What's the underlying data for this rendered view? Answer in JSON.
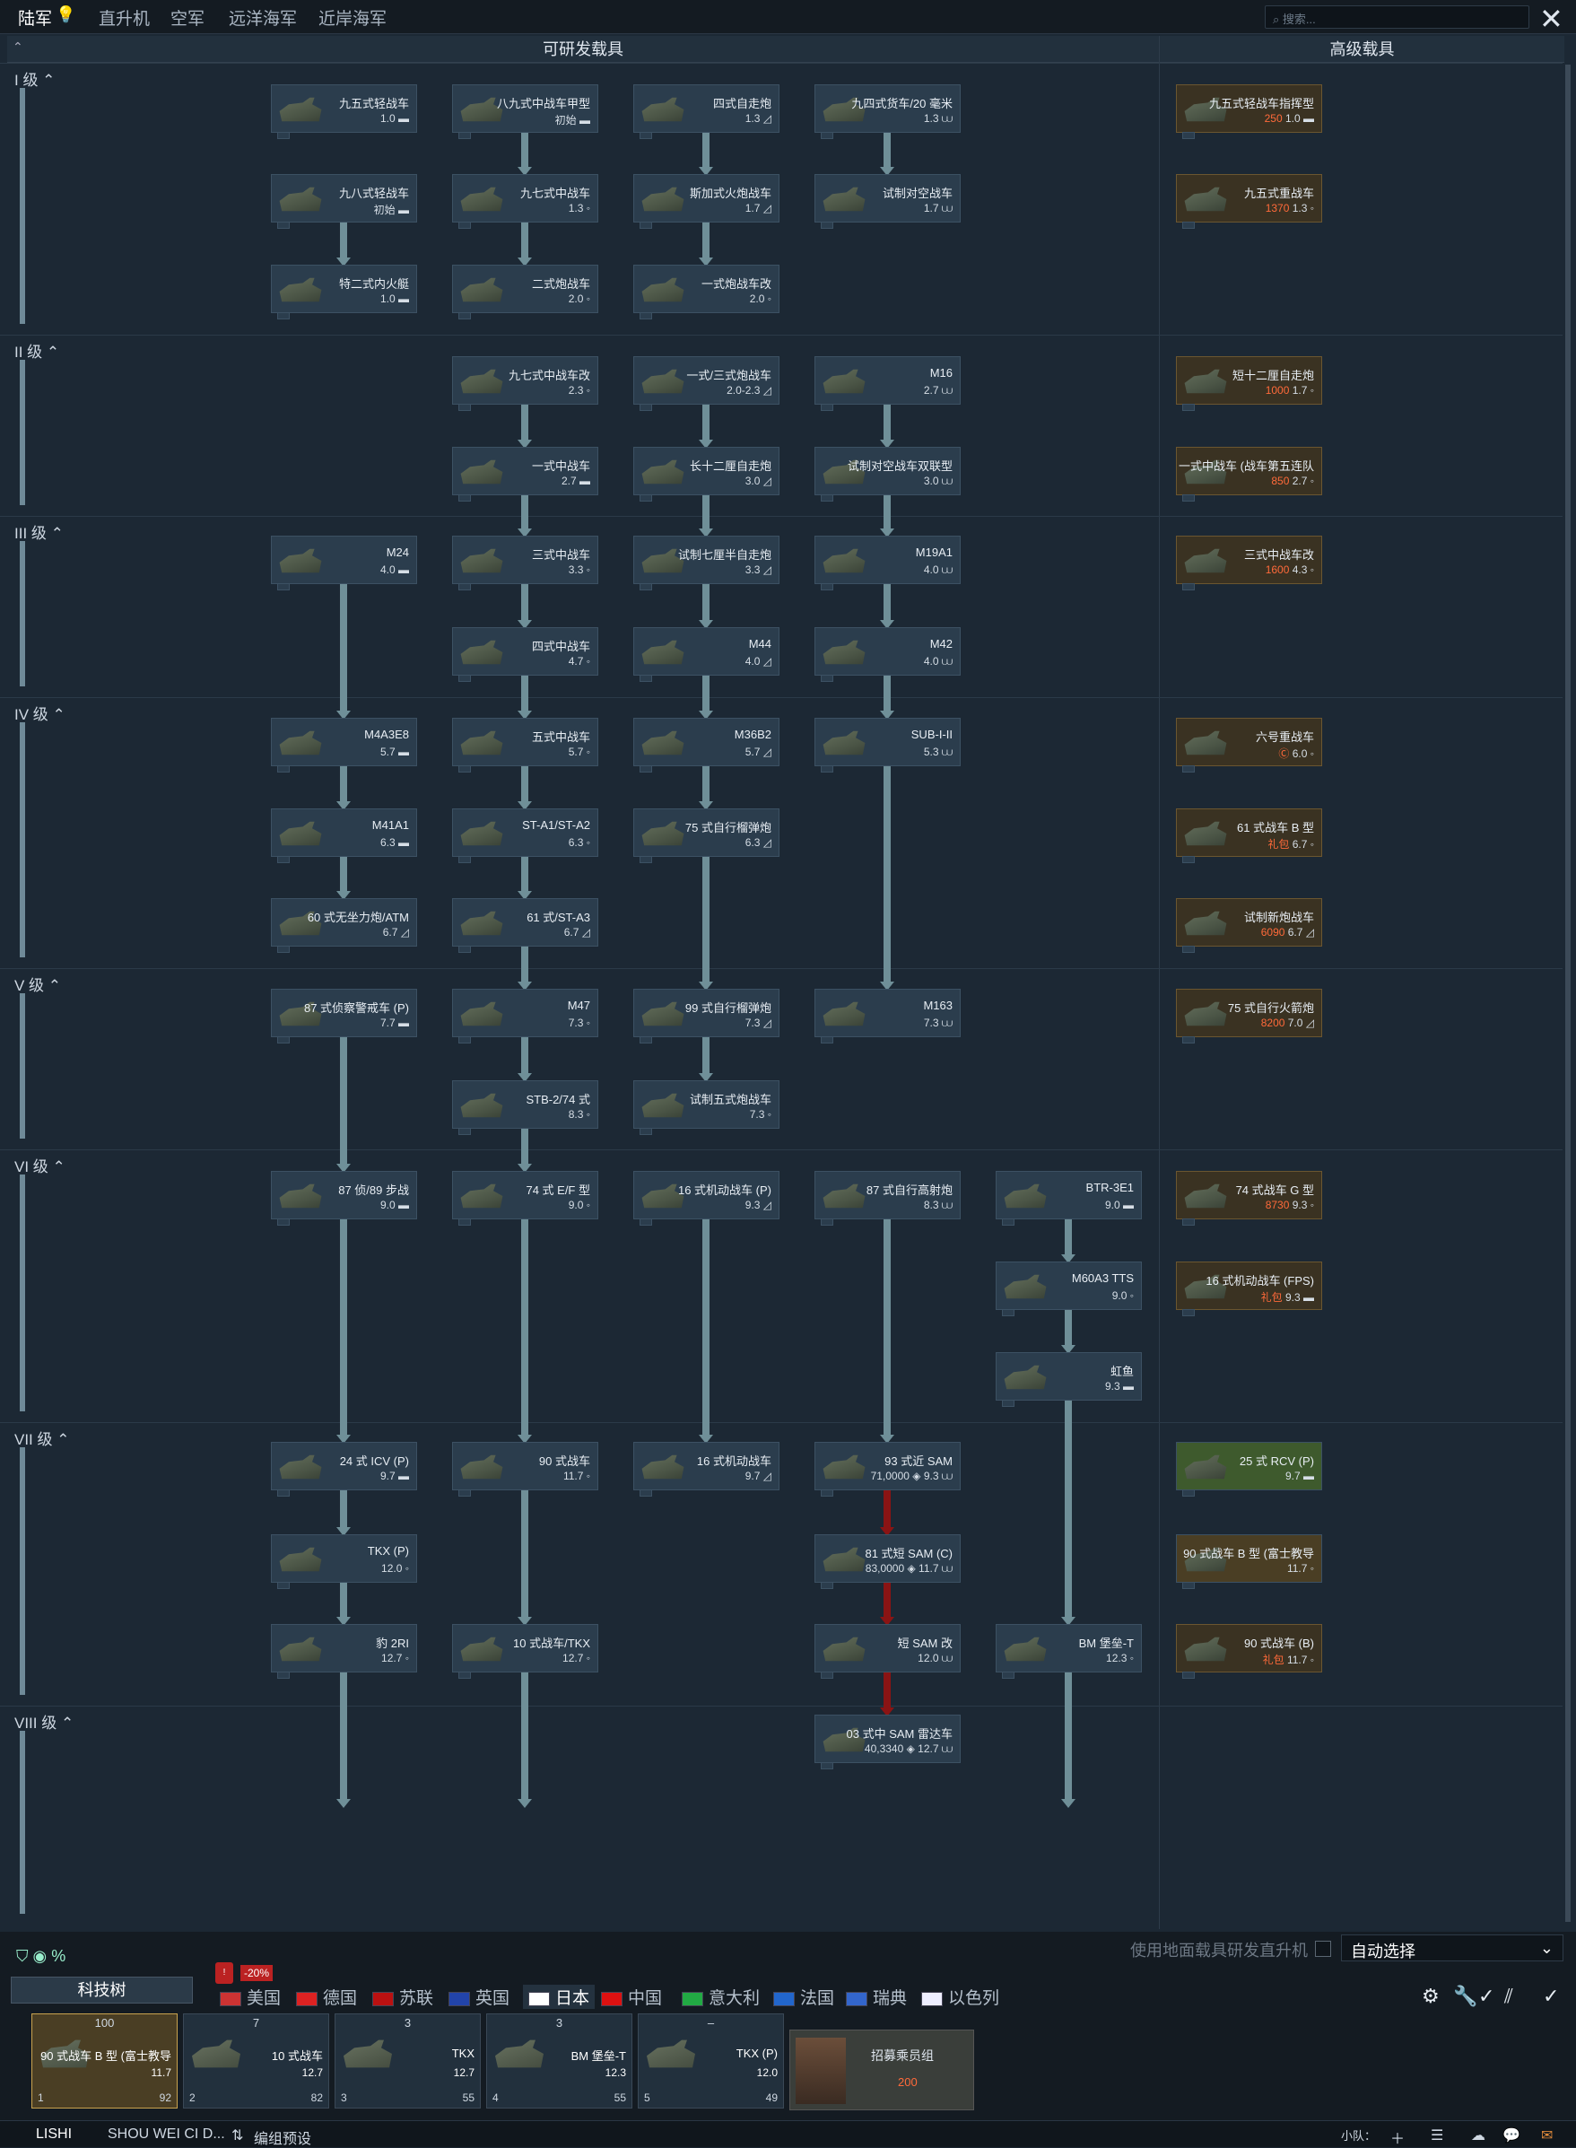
{
  "top_tabs": [
    "陆军",
    "直升机",
    "空军",
    "远洋海军",
    "近岸海军"
  ],
  "search_placeholder": "搜索...",
  "headers": {
    "research": "可研发载具",
    "premium": "高级载具"
  },
  "ranks": [
    "I 级",
    "II 级",
    "III 级",
    "IV 级",
    "V 级",
    "VI 级",
    "VII 级",
    "VIII 级"
  ],
  "cards": [
    {
      "name": "九五式轻战车",
      "sub": "1.0 ▬"
    },
    {
      "name": "八九式中战车甲型",
      "sub": "初始 ▬"
    },
    {
      "name": "四式自走炮",
      "sub": "1.3 ◿"
    },
    {
      "name": "九四式货车/20 毫米",
      "sub": "1.3 ⩊"
    },
    {
      "name": "九八式轻战车",
      "sub": "初始 ▬"
    },
    {
      "name": "九七式中战车",
      "sub": "1.3 ◦"
    },
    {
      "name": "斯加式火炮战车",
      "sub": "1.7 ◿"
    },
    {
      "name": "试制对空战车",
      "sub": "1.7 ⩊"
    },
    {
      "name": "特二式内火艇",
      "sub": "1.0 ▬"
    },
    {
      "name": "二式炮战车",
      "sub": "2.0 ◦"
    },
    {
      "name": "一式炮战车改",
      "sub": "2.0 ◦"
    },
    {
      "name": "九七式中战车改",
      "sub": "2.3 ◦"
    },
    {
      "name": "一式/三式炮战车",
      "sub": "2.0-2.3 ◿"
    },
    {
      "name": "M16",
      "sub": "2.7 ⩊"
    },
    {
      "name": "一式中战车",
      "sub": "2.7 ▬"
    },
    {
      "name": "长十二厘自走炮",
      "sub": "3.0 ◿"
    },
    {
      "name": "试制对空战车双联型",
      "sub": "3.0 ⩊"
    },
    {
      "name": "M24",
      "sub": "4.0 ▬"
    },
    {
      "name": "三式中战车",
      "sub": "3.3 ◦"
    },
    {
      "name": "试制七厘半自走炮",
      "sub": "3.3 ◿"
    },
    {
      "name": "M19A1",
      "sub": "4.0 ⩊"
    },
    {
      "name": "四式中战车",
      "sub": "4.7 ◦"
    },
    {
      "name": "M44",
      "sub": "4.0 ◿"
    },
    {
      "name": "M42",
      "sub": "4.0 ⩊"
    },
    {
      "name": "M4A3E8",
      "sub": "5.7 ▬"
    },
    {
      "name": "五式中战车",
      "sub": "5.7 ◦"
    },
    {
      "name": "M36B2",
      "sub": "5.7 ◿"
    },
    {
      "name": "SUB-I-II",
      "sub": "5.3 ⩊"
    },
    {
      "name": "M41A1",
      "sub": "6.3 ▬"
    },
    {
      "name": "ST-A1/ST-A2",
      "sub": "6.3 ◦"
    },
    {
      "name": "75 式自行榴弹炮",
      "sub": "6.3 ◿"
    },
    {
      "name": "60 式无坐力炮/ATM",
      "sub": "6.7 ◿"
    },
    {
      "name": "61 式/ST-A3",
      "sub": "6.7 ◿"
    },
    {
      "name": "87 式侦察警戒车 (P)",
      "sub": "7.7 ▬"
    },
    {
      "name": "M47",
      "sub": "7.3 ◦"
    },
    {
      "name": "99 式自行榴弹炮",
      "sub": "7.3 ◿"
    },
    {
      "name": "M163",
      "sub": "7.3 ⩊"
    },
    {
      "name": "STB-2/74 式",
      "sub": "8.3 ◦"
    },
    {
      "name": "试制五式炮战车",
      "sub": "7.3 ◦"
    },
    {
      "name": "87 侦/89 步战",
      "sub": "9.0 ▬"
    },
    {
      "name": "74 式 E/F 型",
      "sub": "9.0 ◦"
    },
    {
      "name": "16 式机动战车 (P)",
      "sub": "9.3 ◿"
    },
    {
      "name": "87 式自行高射炮",
      "sub": "8.3 ⩊"
    },
    {
      "name": "BTR-3E1",
      "sub": "9.0 ▬"
    },
    {
      "name": "M60A3 TTS",
      "sub": "9.0 ◦"
    },
    {
      "name": "虹鱼",
      "sub": "9.3 ▬"
    },
    {
      "name": "24 式 ICV (P)",
      "sub": "9.7 ▬"
    },
    {
      "name": "90 式战车",
      "sub": "11.7 ◦"
    },
    {
      "name": "16 式机动战车",
      "sub": "9.7 ◿"
    },
    {
      "name": "93 式近 SAM",
      "sub": "71,0000 ◈ 9.3 ⩊"
    },
    {
      "name": "TKX (P)",
      "sub": "12.0 ◦"
    },
    {
      "name": "81 式短 SAM (C)",
      "sub": "83,0000 ◈ 11.7 ⩊"
    },
    {
      "name": "豹 2RI",
      "sub": "12.7 ◦"
    },
    {
      "name": "10 式战车/TKX",
      "sub": "12.7 ◦"
    },
    {
      "name": "短 SAM 改",
      "sub": "12.0 ⩊"
    },
    {
      "name": "BM 堡垒-T",
      "sub": "12.3 ◦"
    },
    {
      "name": "03 式中 SAM 雷达车",
      "sub": "40,3340 ◈ 12.7 ⩊"
    }
  ],
  "premium": [
    {
      "name": "九五式轻战车指挥型",
      "price": "250",
      "sub": "1.0 ▬"
    },
    {
      "name": "九五式重战车",
      "price": "1370",
      "sub": "1.3 ◦"
    },
    {
      "name": "短十二厘自走炮",
      "price": "1000",
      "sub": "1.7 ◦"
    },
    {
      "name": "一式中战车 (战车第五连队",
      "price": "850",
      "sub": "2.7 ◦"
    },
    {
      "name": "三式中战车改",
      "price": "1600",
      "sub": "4.3 ◦"
    },
    {
      "name": "六号重战车",
      "price": "Ⓒ",
      "sub": "6.0 ◦"
    },
    {
      "name": "61 式战车 B 型",
      "price": "礼包",
      "sub": "6.7 ◦"
    },
    {
      "name": "试制新炮战车",
      "price": "6090",
      "sub": "6.7 ◿"
    },
    {
      "name": "75 式自行火箭炮",
      "price": "8200",
      "sub": "7.0 ◿"
    },
    {
      "name": "74 式战车 G 型",
      "price": "8730",
      "sub": "9.3 ◦"
    },
    {
      "name": "16 式机动战车 (FPS)",
      "price": "礼包",
      "sub": "9.3 ▬"
    },
    {
      "name": "25 式 RCV (P)",
      "price": "",
      "sub": "9.7 ▬"
    },
    {
      "name": "90 式战车 B 型 (富士教导",
      "price": "",
      "sub": "11.7 ◦"
    },
    {
      "name": "90 式战车 (B)",
      "price": "礼包",
      "sub": "11.7 ◦"
    }
  ],
  "option_label": "使用地面载具研发直升机",
  "dropdown": "自动选择",
  "tech_tree_btn": "科技树",
  "nations": [
    "美国",
    "德国",
    "苏联",
    "英国",
    "日本",
    "中国",
    "意大利",
    "法国",
    "瑞典",
    "以色列"
  ],
  "discount": "-20%",
  "crew": [
    {
      "count": "100",
      "name": "90 式战车 B 型 (富士教导",
      "br": "11.7",
      "num": "1",
      "crew": "92"
    },
    {
      "count": "7",
      "name": "10 式战车",
      "br": "12.7",
      "num": "2",
      "crew": "82"
    },
    {
      "count": "3",
      "name": "TKX",
      "br": "12.7",
      "num": "3",
      "crew": "55"
    },
    {
      "count": "3",
      "name": "BM 堡垒-T",
      "br": "12.3",
      "num": "4",
      "crew": "55"
    },
    {
      "count": "–",
      "name": "TKX (P)",
      "br": "12.0",
      "num": "5",
      "crew": "49"
    }
  ],
  "recruit": {
    "label": "招募乘员组",
    "price": "200"
  },
  "status": {
    "user": "LISHI",
    "squad_name": "SHOU WEI CI D...",
    "preset": "编组预设",
    "squad": "小队："
  },
  "colors": {
    "accent": "#e08a3a",
    "premium_price": "#ff6a3a",
    "line": "#6f8f98",
    "red": "#8a1414"
  }
}
